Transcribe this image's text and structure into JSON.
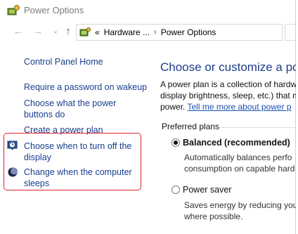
{
  "window": {
    "title": "Power Options"
  },
  "nav": {
    "back": "←",
    "forward": "→",
    "up": "↑",
    "breadcrumb": [
      "«",
      "Hardware ...",
      "›",
      "Power Options"
    ]
  },
  "sidebar": {
    "home": "Control Panel Home",
    "items": [
      "Require a password on wakeup",
      "Choose what the power\nbuttons do",
      "Create a power plan",
      "Choose when to turn off the\ndisplay",
      "Change when the computer\nsleeps"
    ]
  },
  "main": {
    "heading": "Choose or customize a power",
    "description_line1": "A power plan is a collection of hardw",
    "description_line2": "display brightness, sleep, etc.) that m",
    "description_line3_prefix": "power. ",
    "description_link": "Tell me more about power p",
    "preferred_label": "Preferred plans",
    "plans": [
      {
        "name": "Balanced (recommended)",
        "selected": true,
        "desc1": "Automatically balances perfo",
        "desc2": "consumption on capable hard"
      },
      {
        "name": "Power saver",
        "selected": false,
        "desc1": "Saves energy by reducing you",
        "desc2": "where possible."
      }
    ]
  },
  "colors": {
    "link": "#1a3e8f",
    "heading": "#1e3c8c",
    "highlight": "#e0232f"
  }
}
